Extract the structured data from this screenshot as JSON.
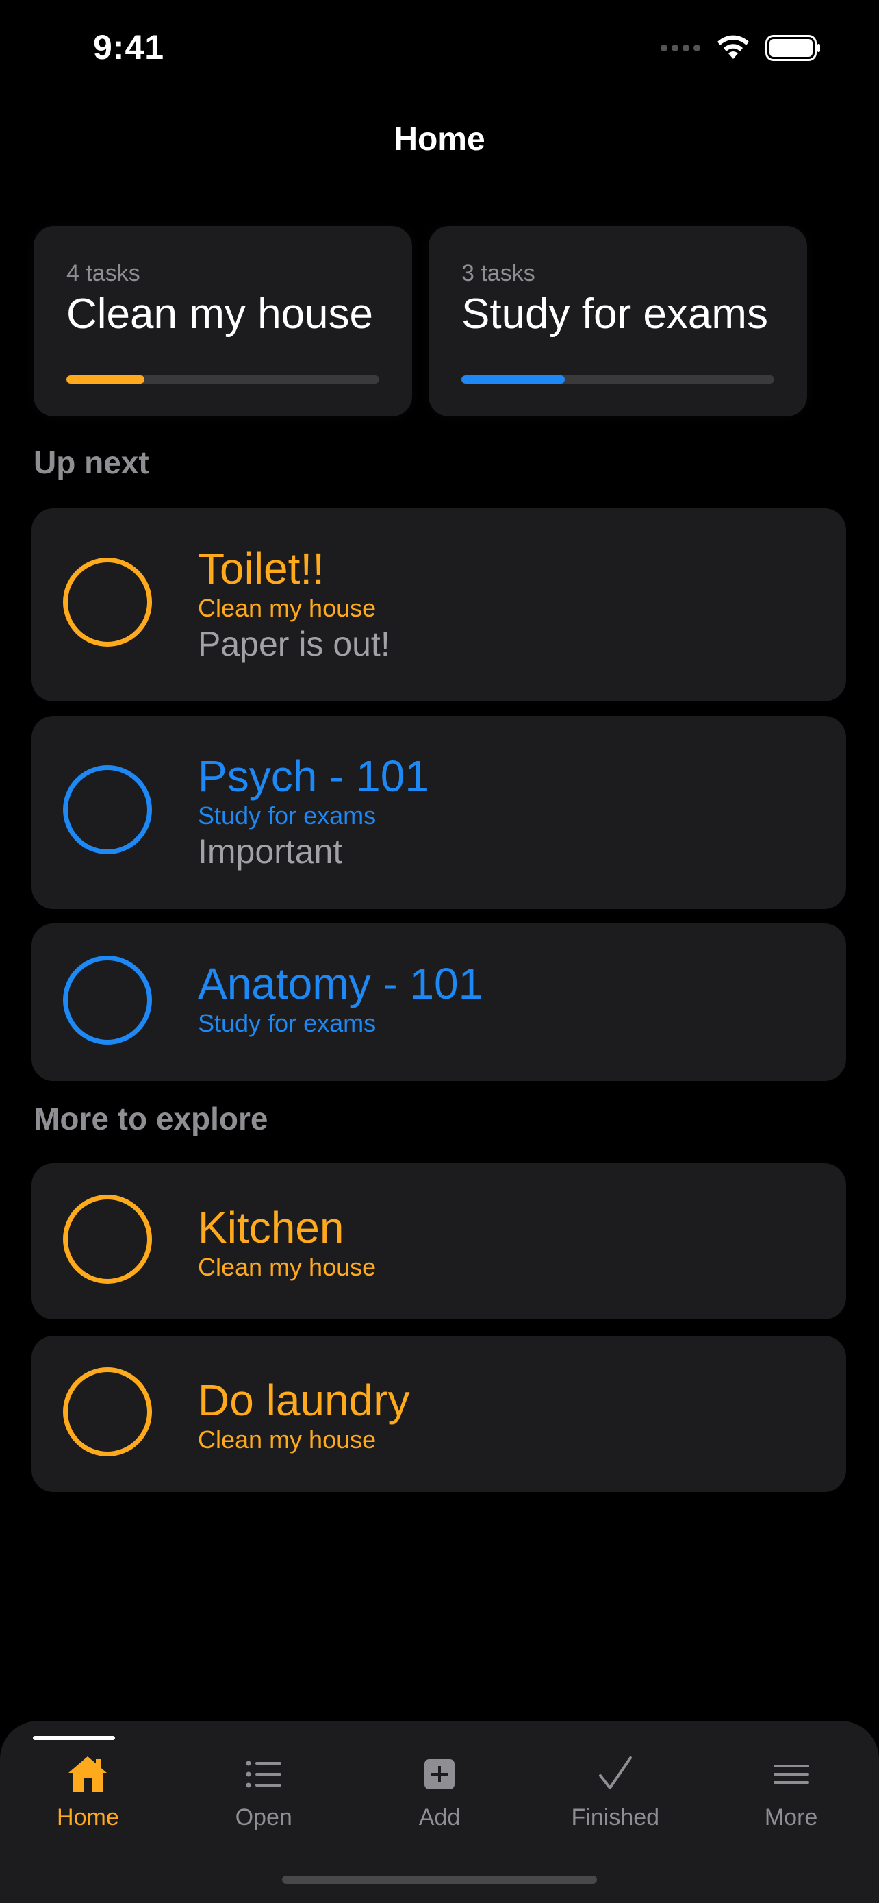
{
  "status_bar": {
    "time": "9:41"
  },
  "nav": {
    "title": "Home"
  },
  "projects": [
    {
      "count": "4 tasks",
      "name": "Clean my house",
      "progress": 0.25,
      "color": "#ffaa1d"
    },
    {
      "count": "3 tasks",
      "name": "Study for exams",
      "progress": 0.33,
      "color": "#1e88f5"
    }
  ],
  "sections": {
    "up_next": "Up next",
    "more_to_explore": "More to explore"
  },
  "up_next": [
    {
      "title": "Toilet!!",
      "project": "Clean my house",
      "note": "Paper is out!",
      "color": "#ffaa1d"
    },
    {
      "title": "Psych - 101",
      "project": "Study for exams",
      "note": "Important",
      "color": "#1e88f5"
    },
    {
      "title": "Anatomy - 101",
      "project": "Study for exams",
      "note": "",
      "color": "#1e88f5"
    }
  ],
  "explore": [
    {
      "title": "Kitchen",
      "project": "Clean my house",
      "color": "#ffaa1d"
    },
    {
      "title": "Do laundry",
      "project": "Clean my house",
      "color": "#ffaa1d"
    }
  ],
  "tabs": [
    {
      "label": "Home",
      "icon": "house-icon",
      "active": true
    },
    {
      "label": "Open",
      "icon": "list-icon",
      "active": false
    },
    {
      "label": "Add",
      "icon": "plus-square-icon",
      "active": false
    },
    {
      "label": "Finished",
      "icon": "checkmark-icon",
      "active": false
    },
    {
      "label": "More",
      "icon": "menu-icon",
      "active": false
    }
  ],
  "colors": {
    "accent_orange": "#ffaa1d",
    "accent_blue": "#1e88f5",
    "card": "#1c1c1e"
  }
}
